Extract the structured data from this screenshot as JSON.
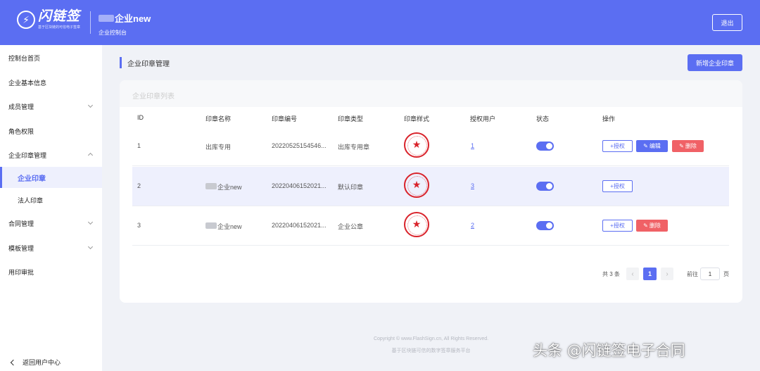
{
  "header": {
    "logo_name": "闪链签",
    "logo_sub": "基于区块链的可信电子签章",
    "company_name": "企业new",
    "company_sub": "企业控制台",
    "logout_label": "退出"
  },
  "sidebar": {
    "items": [
      {
        "label": "控制台首页"
      },
      {
        "label": "企业基本信息"
      },
      {
        "label": "成员管理"
      },
      {
        "label": "角色权限"
      },
      {
        "label": "企业印章管理"
      },
      {
        "label": "企业印章"
      },
      {
        "label": "法人印章"
      },
      {
        "label": "合同管理"
      },
      {
        "label": "模板管理"
      },
      {
        "label": "用印审批"
      }
    ],
    "back_label": "返回用户中心"
  },
  "main": {
    "page_title": "企业印章管理",
    "add_button": "新增企业印章",
    "card_title": "企业印章列表",
    "columns": [
      "ID",
      "印章名称",
      "印章编号",
      "印章类型",
      "印章样式",
      "授权用户",
      "状态",
      "操作"
    ],
    "rows": [
      {
        "id": "1",
        "name": "出库专用",
        "code": "20220525154546...",
        "type": "出库专用章",
        "users": "1",
        "actions": [
          "+授权",
          "编辑",
          "删除"
        ]
      },
      {
        "id": "2",
        "name": "企业new",
        "code": "20220406152021...",
        "type": "默认印章",
        "users": "3",
        "actions": [
          "+授权"
        ]
      },
      {
        "id": "3",
        "name": "企业new",
        "code": "20220406152021...",
        "type": "企业公章",
        "users": "2",
        "actions": [
          "+授权",
          "删除"
        ]
      }
    ],
    "pagination": {
      "total": "共 3 条",
      "prev": "‹",
      "current": "1",
      "next": "›",
      "goto": "前往",
      "page_value": "1",
      "page_unit": "页"
    }
  },
  "footer": {
    "copyright": "Copyright © www.FlashSign.cn, All Rights Reserved.",
    "tagline": "基于区块链可信的数字签章服务平台"
  },
  "watermark": "头条 @闪链签电子合同",
  "colors": {
    "accent": "#5b6ef2",
    "danger": "#f06166",
    "seal": "#d9232b"
  }
}
